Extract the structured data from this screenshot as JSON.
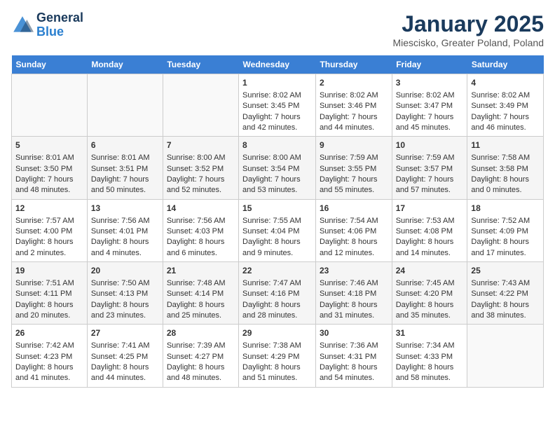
{
  "logo": {
    "line1": "General",
    "line2": "Blue"
  },
  "title": "January 2025",
  "subtitle": "Miescisko, Greater Poland, Poland",
  "days_of_week": [
    "Sunday",
    "Monday",
    "Tuesday",
    "Wednesday",
    "Thursday",
    "Friday",
    "Saturday"
  ],
  "weeks": [
    [
      {
        "day": "",
        "content": ""
      },
      {
        "day": "",
        "content": ""
      },
      {
        "day": "",
        "content": ""
      },
      {
        "day": "1",
        "content": "Sunrise: 8:02 AM\nSunset: 3:45 PM\nDaylight: 7 hours and 42 minutes."
      },
      {
        "day": "2",
        "content": "Sunrise: 8:02 AM\nSunset: 3:46 PM\nDaylight: 7 hours and 44 minutes."
      },
      {
        "day": "3",
        "content": "Sunrise: 8:02 AM\nSunset: 3:47 PM\nDaylight: 7 hours and 45 minutes."
      },
      {
        "day": "4",
        "content": "Sunrise: 8:02 AM\nSunset: 3:49 PM\nDaylight: 7 hours and 46 minutes."
      }
    ],
    [
      {
        "day": "5",
        "content": "Sunrise: 8:01 AM\nSunset: 3:50 PM\nDaylight: 7 hours and 48 minutes."
      },
      {
        "day": "6",
        "content": "Sunrise: 8:01 AM\nSunset: 3:51 PM\nDaylight: 7 hours and 50 minutes."
      },
      {
        "day": "7",
        "content": "Sunrise: 8:00 AM\nSunset: 3:52 PM\nDaylight: 7 hours and 52 minutes."
      },
      {
        "day": "8",
        "content": "Sunrise: 8:00 AM\nSunset: 3:54 PM\nDaylight: 7 hours and 53 minutes."
      },
      {
        "day": "9",
        "content": "Sunrise: 7:59 AM\nSunset: 3:55 PM\nDaylight: 7 hours and 55 minutes."
      },
      {
        "day": "10",
        "content": "Sunrise: 7:59 AM\nSunset: 3:57 PM\nDaylight: 7 hours and 57 minutes."
      },
      {
        "day": "11",
        "content": "Sunrise: 7:58 AM\nSunset: 3:58 PM\nDaylight: 8 hours and 0 minutes."
      }
    ],
    [
      {
        "day": "12",
        "content": "Sunrise: 7:57 AM\nSunset: 4:00 PM\nDaylight: 8 hours and 2 minutes."
      },
      {
        "day": "13",
        "content": "Sunrise: 7:56 AM\nSunset: 4:01 PM\nDaylight: 8 hours and 4 minutes."
      },
      {
        "day": "14",
        "content": "Sunrise: 7:56 AM\nSunset: 4:03 PM\nDaylight: 8 hours and 6 minutes."
      },
      {
        "day": "15",
        "content": "Sunrise: 7:55 AM\nSunset: 4:04 PM\nDaylight: 8 hours and 9 minutes."
      },
      {
        "day": "16",
        "content": "Sunrise: 7:54 AM\nSunset: 4:06 PM\nDaylight: 8 hours and 12 minutes."
      },
      {
        "day": "17",
        "content": "Sunrise: 7:53 AM\nSunset: 4:08 PM\nDaylight: 8 hours and 14 minutes."
      },
      {
        "day": "18",
        "content": "Sunrise: 7:52 AM\nSunset: 4:09 PM\nDaylight: 8 hours and 17 minutes."
      }
    ],
    [
      {
        "day": "19",
        "content": "Sunrise: 7:51 AM\nSunset: 4:11 PM\nDaylight: 8 hours and 20 minutes."
      },
      {
        "day": "20",
        "content": "Sunrise: 7:50 AM\nSunset: 4:13 PM\nDaylight: 8 hours and 23 minutes."
      },
      {
        "day": "21",
        "content": "Sunrise: 7:48 AM\nSunset: 4:14 PM\nDaylight: 8 hours and 25 minutes."
      },
      {
        "day": "22",
        "content": "Sunrise: 7:47 AM\nSunset: 4:16 PM\nDaylight: 8 hours and 28 minutes."
      },
      {
        "day": "23",
        "content": "Sunrise: 7:46 AM\nSunset: 4:18 PM\nDaylight: 8 hours and 31 minutes."
      },
      {
        "day": "24",
        "content": "Sunrise: 7:45 AM\nSunset: 4:20 PM\nDaylight: 8 hours and 35 minutes."
      },
      {
        "day": "25",
        "content": "Sunrise: 7:43 AM\nSunset: 4:22 PM\nDaylight: 8 hours and 38 minutes."
      }
    ],
    [
      {
        "day": "26",
        "content": "Sunrise: 7:42 AM\nSunset: 4:23 PM\nDaylight: 8 hours and 41 minutes."
      },
      {
        "day": "27",
        "content": "Sunrise: 7:41 AM\nSunset: 4:25 PM\nDaylight: 8 hours and 44 minutes."
      },
      {
        "day": "28",
        "content": "Sunrise: 7:39 AM\nSunset: 4:27 PM\nDaylight: 8 hours and 48 minutes."
      },
      {
        "day": "29",
        "content": "Sunrise: 7:38 AM\nSunset: 4:29 PM\nDaylight: 8 hours and 51 minutes."
      },
      {
        "day": "30",
        "content": "Sunrise: 7:36 AM\nSunset: 4:31 PM\nDaylight: 8 hours and 54 minutes."
      },
      {
        "day": "31",
        "content": "Sunrise: 7:34 AM\nSunset: 4:33 PM\nDaylight: 8 hours and 58 minutes."
      },
      {
        "day": "",
        "content": ""
      }
    ]
  ]
}
